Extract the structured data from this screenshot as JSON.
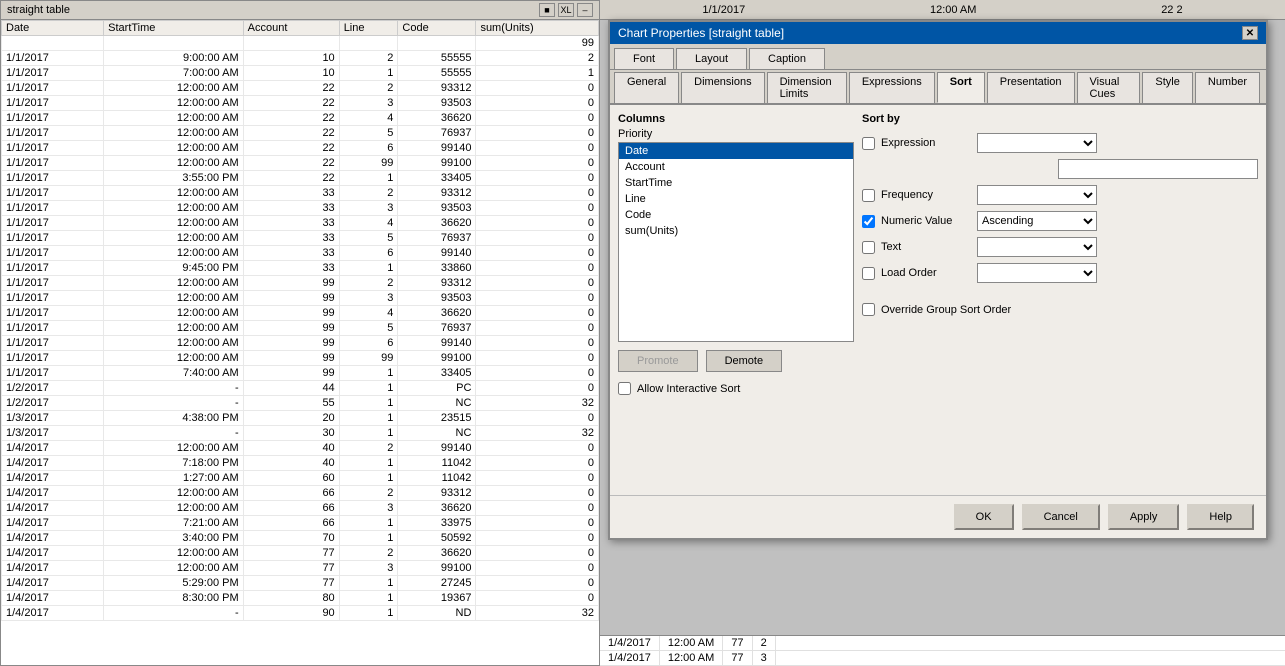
{
  "bgTable": {
    "title": "straight table",
    "titleButtons": [
      "■",
      "XL",
      "–",
      "✕"
    ],
    "columns": [
      "Date",
      "StartTime",
      "Account",
      "Line",
      "Code",
      "sum(Units)"
    ],
    "rows": [
      [
        "",
        "",
        "",
        "",
        "",
        "99"
      ],
      [
        "1/1/2017",
        "9:00:00 AM",
        "10",
        "2",
        "55555",
        "2"
      ],
      [
        "1/1/2017",
        "7:00:00 AM",
        "10",
        "1",
        "55555",
        "1"
      ],
      [
        "1/1/2017",
        "12:00:00 AM",
        "22",
        "2",
        "93312",
        "0"
      ],
      [
        "1/1/2017",
        "12:00:00 AM",
        "22",
        "3",
        "93503",
        "0"
      ],
      [
        "1/1/2017",
        "12:00:00 AM",
        "22",
        "4",
        "36620",
        "0"
      ],
      [
        "1/1/2017",
        "12:00:00 AM",
        "22",
        "5",
        "76937",
        "0"
      ],
      [
        "1/1/2017",
        "12:00:00 AM",
        "22",
        "6",
        "99140",
        "0"
      ],
      [
        "1/1/2017",
        "12:00:00 AM",
        "22",
        "99",
        "99100",
        "0"
      ],
      [
        "1/1/2017",
        "3:55:00 PM",
        "22",
        "1",
        "33405",
        "0"
      ],
      [
        "1/1/2017",
        "12:00:00 AM",
        "33",
        "2",
        "93312",
        "0"
      ],
      [
        "1/1/2017",
        "12:00:00 AM",
        "33",
        "3",
        "93503",
        "0"
      ],
      [
        "1/1/2017",
        "12:00:00 AM",
        "33",
        "4",
        "36620",
        "0"
      ],
      [
        "1/1/2017",
        "12:00:00 AM",
        "33",
        "5",
        "76937",
        "0"
      ],
      [
        "1/1/2017",
        "12:00:00 AM",
        "33",
        "6",
        "99140",
        "0"
      ],
      [
        "1/1/2017",
        "9:45:00 PM",
        "33",
        "1",
        "33860",
        "0"
      ],
      [
        "1/1/2017",
        "12:00:00 AM",
        "99",
        "2",
        "93312",
        "0"
      ],
      [
        "1/1/2017",
        "12:00:00 AM",
        "99",
        "3",
        "93503",
        "0"
      ],
      [
        "1/1/2017",
        "12:00:00 AM",
        "99",
        "4",
        "36620",
        "0"
      ],
      [
        "1/1/2017",
        "12:00:00 AM",
        "99",
        "5",
        "76937",
        "0"
      ],
      [
        "1/1/2017",
        "12:00:00 AM",
        "99",
        "6",
        "99140",
        "0"
      ],
      [
        "1/1/2017",
        "12:00:00 AM",
        "99",
        "99",
        "99100",
        "0"
      ],
      [
        "1/1/2017",
        "7:40:00 AM",
        "99",
        "1",
        "33405",
        "0"
      ],
      [
        "1/2/2017",
        "-",
        "44",
        "1",
        "PC",
        "0"
      ],
      [
        "1/2/2017",
        "-",
        "55",
        "1",
        "NC",
        "32"
      ],
      [
        "1/3/2017",
        "4:38:00 PM",
        "20",
        "1",
        "23515",
        "0"
      ],
      [
        "1/3/2017",
        "-",
        "30",
        "1",
        "NC",
        "32"
      ],
      [
        "1/4/2017",
        "12:00:00 AM",
        "40",
        "2",
        "99140",
        "0"
      ],
      [
        "1/4/2017",
        "7:18:00 PM",
        "40",
        "1",
        "11042",
        "0"
      ],
      [
        "1/4/2017",
        "1:27:00 AM",
        "60",
        "1",
        "11042",
        "0"
      ],
      [
        "1/4/2017",
        "12:00:00 AM",
        "66",
        "2",
        "93312",
        "0"
      ],
      [
        "1/4/2017",
        "12:00:00 AM",
        "66",
        "3",
        "36620",
        "0"
      ],
      [
        "1/4/2017",
        "7:21:00 AM",
        "66",
        "1",
        "33975",
        "0"
      ],
      [
        "1/4/2017",
        "3:40:00 PM",
        "70",
        "1",
        "50592",
        "0"
      ],
      [
        "1/4/2017",
        "12:00:00 AM",
        "77",
        "2",
        "36620",
        "0"
      ],
      [
        "1/4/2017",
        "12:00:00 AM",
        "77",
        "3",
        "99100",
        "0"
      ],
      [
        "1/4/2017",
        "5:29:00 PM",
        "77",
        "1",
        "27245",
        "0"
      ],
      [
        "1/4/2017",
        "8:30:00 PM",
        "80",
        "1",
        "19367",
        "0"
      ],
      [
        "1/4/2017",
        "-",
        "90",
        "1",
        "ND",
        "32"
      ]
    ]
  },
  "topBar": {
    "date": "1/1/2017",
    "time": "12:00 AM",
    "value": "22 2"
  },
  "dialog": {
    "title": "Chart Properties [straight table]",
    "closeBtn": "✕",
    "tabs1": [
      {
        "label": "Font",
        "active": false
      },
      {
        "label": "Layout",
        "active": false
      },
      {
        "label": "Caption",
        "active": false
      }
    ],
    "tabs2": [
      {
        "label": "General",
        "active": false
      },
      {
        "label": "Dimensions",
        "active": false
      },
      {
        "label": "Dimension Limits",
        "active": false
      },
      {
        "label": "Expressions",
        "active": false
      },
      {
        "label": "Sort",
        "active": true
      },
      {
        "label": "Presentation",
        "active": false
      },
      {
        "label": "Visual Cues",
        "active": false
      },
      {
        "label": "Style",
        "active": false
      },
      {
        "label": "Number",
        "active": false
      }
    ],
    "columnsLabel": "Columns",
    "priorityLabel": "Priority",
    "listItems": [
      {
        "label": "Date",
        "selected": true
      },
      {
        "label": "Account",
        "selected": false
      },
      {
        "label": "StartTime",
        "selected": false
      },
      {
        "label": "Line",
        "selected": false
      },
      {
        "label": "Code",
        "selected": false
      },
      {
        "label": "sum(Units)",
        "selected": false
      }
    ],
    "promoteBtn": "Promote",
    "demoteBtn": "Demote",
    "allowInteractiveSort": "Allow Interactive Sort",
    "sortByLabel": "Sort by",
    "expression": {
      "label": "Expression",
      "checked": false,
      "dropdownValue": "",
      "textValue": ""
    },
    "frequency": {
      "label": "Frequency",
      "checked": false,
      "dropdownValue": ""
    },
    "numericValue": {
      "label": "Numeric Value",
      "checked": true,
      "dropdownValue": "Ascending"
    },
    "text": {
      "label": "Text",
      "checked": false,
      "dropdownValue": ""
    },
    "loadOrder": {
      "label": "Load Order",
      "checked": false,
      "dropdownValue": ""
    },
    "overrideGroupSortOrder": "Override Group Sort Order",
    "footer": {
      "ok": "OK",
      "cancel": "Cancel",
      "apply": "Apply",
      "help": "Help"
    }
  },
  "bottomBar": {
    "rows": [
      [
        "1/4/2017",
        "12:00 AM",
        "77",
        "2"
      ],
      [
        "1/4/2017",
        "12:00 AM",
        "77",
        "3"
      ]
    ]
  }
}
